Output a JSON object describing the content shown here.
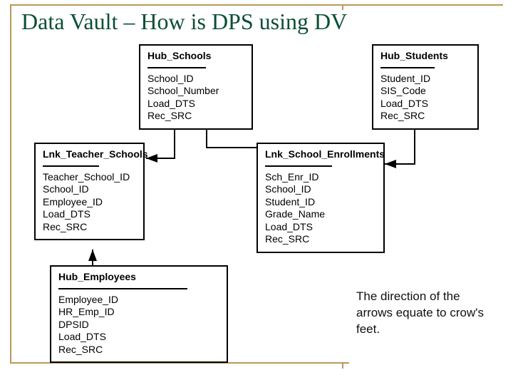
{
  "title": "Data Vault – How is DPS using DV",
  "entities": {
    "hub_schools": {
      "name": "Hub_Schools",
      "fields": [
        "School_ID",
        "School_Number",
        "Load_DTS",
        "Rec_SRC"
      ]
    },
    "hub_students": {
      "name": "Hub_Students",
      "fields": [
        "Student_ID",
        "SIS_Code",
        "Load_DTS",
        "Rec_SRC"
      ]
    },
    "lnk_teacher_schools": {
      "name": "Lnk_Teacher_Schools",
      "fields": [
        "Teacher_School_ID",
        "School_ID",
        "Employee_ID",
        "Load_DTS",
        "Rec_SRC"
      ]
    },
    "lnk_school_enrollments": {
      "name": "Lnk_School_Enrollments",
      "fields": [
        "Sch_Enr_ID",
        "School_ID",
        "Student_ID",
        "Grade_Name",
        "Load_DTS",
        "Rec_SRC"
      ]
    },
    "hub_employees": {
      "name": "Hub_Employees",
      "fields": [
        "Employee_ID",
        "HR_Emp_ID",
        "DPSID",
        "Load_DTS",
        "Rec_SRC"
      ]
    }
  },
  "note": "The direction of the arrows equate to crow's feet.",
  "connectors": [
    {
      "from": "hub_schools",
      "to": "lnk_teacher_schools"
    },
    {
      "from": "hub_schools",
      "to": "lnk_school_enrollments"
    },
    {
      "from": "hub_students",
      "to": "lnk_school_enrollments"
    },
    {
      "from": "hub_employees",
      "to": "lnk_teacher_schools"
    }
  ]
}
